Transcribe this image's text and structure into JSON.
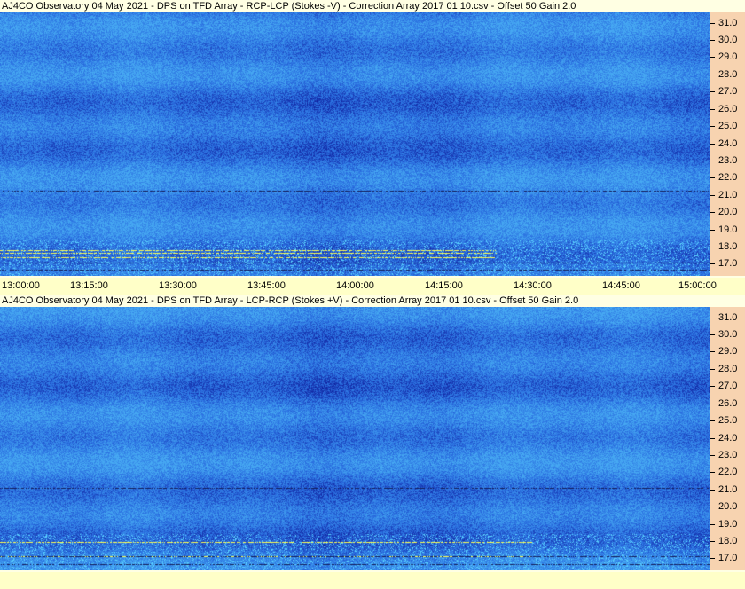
{
  "window": {
    "title_top": "AJ4CO Observatory 04 May 2021  -  DPS on TFD Array  -  RCP-LCP (Stokes -V)  -  Correction Array 2017 01 10.csv  -  Offset 50  Gain 2.0",
    "title_bottom": "AJ4CO Observatory 04 May 2021  -  DPS on TFD Array  -  LCP-RCP (Stokes +V)  -  Correction Array 2017 01 10.csv  -  Offset 50  Gain 2.0"
  },
  "chart_data": [
    {
      "type": "heatmap",
      "title": "AJ4CO Observatory 04 May 2021  -  DPS on TFD Array  -  RCP-LCP (Stokes -V)  -  Correction Array 2017 01 10.csv  -  Offset 50  Gain 2.0",
      "x_ticks": [
        "13:00:00",
        "13:15:00",
        "13:30:00",
        "13:45:00",
        "14:00:00",
        "14:15:00",
        "14:30:00",
        "14:45:00",
        "15:00:00"
      ],
      "y_ticks": [
        "31.0",
        "30.0",
        "29.0",
        "28.0",
        "27.0",
        "26.0",
        "25.0",
        "24.0",
        "23.0",
        "22.0",
        "21.0",
        "20.0",
        "19.0",
        "18.0",
        "17.0"
      ],
      "x_range": [
        "13:00:00",
        "15:00:00"
      ],
      "y_range": [
        16.3,
        31.6
      ],
      "colors": {
        "background": "#2a6ee0",
        "dark": "#1a3fb8",
        "bright": "#5ad2ff",
        "hot": "#ffff50"
      }
    },
    {
      "type": "heatmap",
      "title": "AJ4CO Observatory 04 May 2021  -  DPS on TFD Array  -  LCP-RCP (Stokes +V)  -  Correction Array 2017 01 10.csv  -  Offset 50  Gain 2.0",
      "x_ticks": [
        "13:00:00",
        "13:15:00",
        "13:30:00",
        "13:45:00",
        "14:00:00",
        "14:15:00",
        "14:30:00",
        "14:45:00",
        "15:00:00"
      ],
      "y_ticks": [
        "31.0",
        "30.0",
        "29.0",
        "28.0",
        "27.0",
        "26.0",
        "25.0",
        "24.0",
        "23.0",
        "22.0",
        "21.0",
        "20.0",
        "19.0",
        "18.0",
        "17.0"
      ],
      "x_range": [
        "13:00:00",
        "15:00:00"
      ],
      "y_range": [
        16.3,
        31.6
      ],
      "colors": {
        "background": "#2a6ee0",
        "dark": "#1a3fb8",
        "bright": "#5ad2ff",
        "hot": "#ffff50"
      }
    }
  ]
}
